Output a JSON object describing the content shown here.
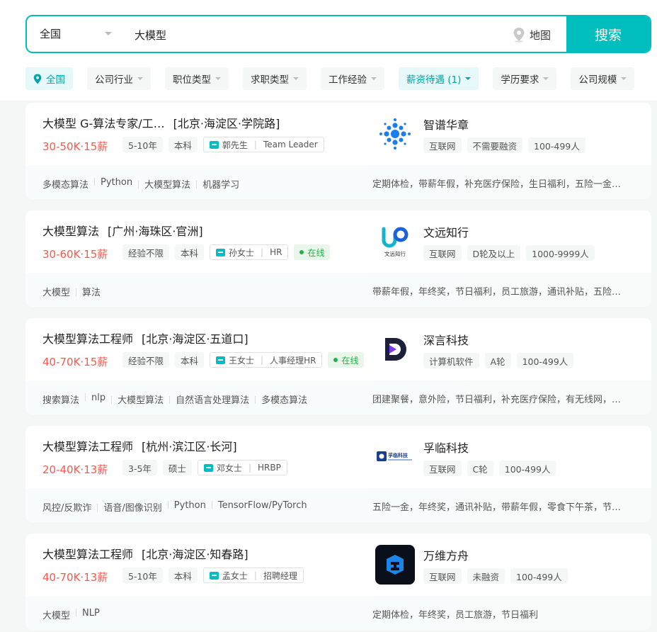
{
  "search": {
    "city": "全国",
    "query": "大模型",
    "map_label": "地图",
    "button_label": "搜索"
  },
  "filters": [
    {
      "label": "全国",
      "active": true,
      "icon": "location-pin-icon"
    },
    {
      "label": "公司行业",
      "active": false
    },
    {
      "label": "职位类型",
      "active": false
    },
    {
      "label": "求职类型",
      "active": false
    },
    {
      "label": "工作经验",
      "active": false
    },
    {
      "label": "薪资待遇 (1)",
      "active": true
    },
    {
      "label": "学历要求",
      "active": false
    },
    {
      "label": "公司规模",
      "active": false
    }
  ],
  "colors": {
    "accent": "#00bebd",
    "salary": "#fe574a",
    "online": "#22b14c"
  },
  "jobs": [
    {
      "title": "大模型 G-算法专家/工…",
      "location": "[北京·海淀区·学院路]",
      "salary": "30-50K·15薪",
      "tags": [
        "5-10年",
        "本科"
      ],
      "recruiter_name": "郭先生",
      "recruiter_role": "Team Leader",
      "online": "",
      "skills": [
        "多模态算法",
        "Python",
        "大模型算法",
        "机器学习"
      ],
      "company": "智谱华章",
      "company_tags": [
        "互联网",
        "不需要融资",
        "100-499人"
      ],
      "welfare": "定期体检，带薪年假，补充医疗保险，生日福利，五险一金，节日福利",
      "logo_icon": "zhipu-logo-icon"
    },
    {
      "title": "大模型算法",
      "location": "[广州·海珠区·官洲]",
      "salary": "30-60K·15薪",
      "tags": [
        "经验不限",
        "本科"
      ],
      "recruiter_name": "孙女士",
      "recruiter_role": "HR",
      "online": "在线",
      "skills": [
        "大模型",
        "算法"
      ],
      "company": "文远知行",
      "company_tags": [
        "互联网",
        "D轮及以上",
        "1000-9999人"
      ],
      "welfare": "带薪年假，年终奖，节日福利，员工旅游，通讯补贴，五险一金，定期体检",
      "logo_icon": "weride-logo-icon",
      "logo_text": "文远知行"
    },
    {
      "title": "大模型算法工程师",
      "location": "[北京·海淀区·五道口]",
      "salary": "40-70K·15薪",
      "tags": [
        "经验不限",
        "本科"
      ],
      "recruiter_name": "王女士",
      "recruiter_role": "人事经理HR",
      "online": "在线",
      "skills": [
        "搜索算法",
        "nlp",
        "大模型算法",
        "自然语言处理算法",
        "多模态算法"
      ],
      "company": "深言科技",
      "company_tags": [
        "计算机软件",
        "A轮",
        "100-499人"
      ],
      "welfare": "团建聚餐，意外险，节日福利，补充医疗保险，有无线网，定期体检",
      "logo_icon": "shenyan-logo-icon"
    },
    {
      "title": "大模型算法工程师",
      "location": "[杭州·滨江区·长河]",
      "salary": "20-40K·13薪",
      "tags": [
        "3-5年",
        "硕士"
      ],
      "recruiter_name": "邓女士",
      "recruiter_role": "HRBP",
      "online": "",
      "skills": [
        "风控/反欺诈",
        "语音/图像识别",
        "Python",
        "TensorFlow/PyTorch"
      ],
      "company": "孚临科技",
      "company_tags": [
        "互联网",
        "C轮",
        "100-499人"
      ],
      "welfare": "五险一金，年终奖，通讯补贴，带薪年假，零食下午茶，节日福利",
      "logo_icon": "fulin-logo-icon",
      "logo_text": "孚临科技"
    },
    {
      "title": "大模型算法工程师",
      "location": "[北京·海淀区·知春路]",
      "salary": "40-70K·13薪",
      "tags": [
        "5-10年",
        "本科"
      ],
      "recruiter_name": "孟女士",
      "recruiter_role": "招聘经理",
      "online": "",
      "skills": [
        "大模型",
        "NLP"
      ],
      "company": "万维方舟",
      "company_tags": [
        "互联网",
        "未融资",
        "100-499人"
      ],
      "welfare": "定期体检，年终奖，员工旅游，节日福利",
      "logo_icon": "wanwei-logo-icon"
    }
  ]
}
